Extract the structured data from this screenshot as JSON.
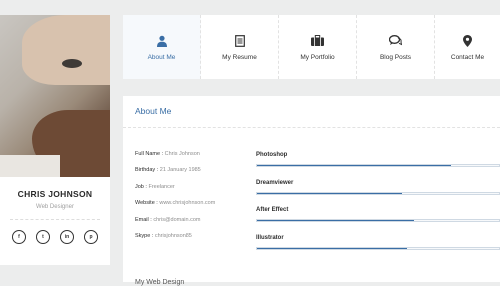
{
  "profile": {
    "name": "CHRIS JOHNSON",
    "role": "Web Designer",
    "social": [
      {
        "icon": "facebook-icon",
        "glyph": "f"
      },
      {
        "icon": "twitter-icon",
        "glyph": "t"
      },
      {
        "icon": "linkedin-icon",
        "glyph": "in"
      },
      {
        "icon": "pinterest-icon",
        "glyph": "p"
      }
    ]
  },
  "nav": {
    "items": [
      {
        "label": "About Me",
        "icon": "user-icon",
        "active": true
      },
      {
        "label": "My Resume",
        "icon": "document-icon",
        "active": false
      },
      {
        "label": "My Portfolio",
        "icon": "briefcase-icon",
        "active": false
      },
      {
        "label": "Blog Posts",
        "icon": "chat-icon",
        "active": false
      },
      {
        "label": "Contact Me",
        "icon": "location-pin-icon",
        "active": false
      }
    ]
  },
  "about": {
    "title": "About Me",
    "info": [
      {
        "label": "Full Name :",
        "value": "Chris Johnson"
      },
      {
        "label": "Birthday :",
        "value": "21 January 1985"
      },
      {
        "label": "Job :",
        "value": "Freelancer"
      },
      {
        "label": "Website :",
        "value": "www.chrisjohnson.com"
      },
      {
        "label": "Email :",
        "value": "chris@domain.com"
      },
      {
        "label": "Skype :",
        "value": "chrisjohnson85"
      }
    ],
    "skills": [
      {
        "name": "Photoshop",
        "level": 0.8
      },
      {
        "name": "Dreamviewer",
        "level": 0.6
      },
      {
        "name": "After Effect",
        "level": 0.65
      },
      {
        "name": "Illustrator",
        "level": 0.62
      }
    ],
    "next_heading": "My Web Design"
  },
  "colors": {
    "accent": "#3a6ea5",
    "background": "#eceded"
  }
}
